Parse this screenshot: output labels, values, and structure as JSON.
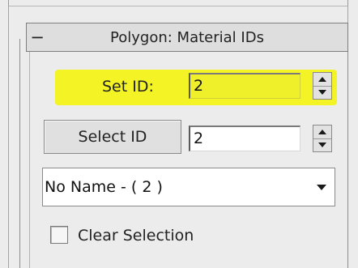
{
  "rollout": {
    "toggle": "−",
    "title": "Polygon: Material IDs"
  },
  "set_id": {
    "label": "Set ID:",
    "value": "2",
    "highlight_color": "#f3f326"
  },
  "select_id": {
    "button_label": "Select ID",
    "value": "2"
  },
  "name_dropdown": {
    "selected": "No Name - ( 2 )"
  },
  "clear_selection": {
    "label": "Clear Selection",
    "checked": false
  },
  "icons": {
    "spinner_up": "triangle-up-icon",
    "spinner_down": "triangle-down-icon",
    "dropdown": "chevron-down-icon"
  }
}
